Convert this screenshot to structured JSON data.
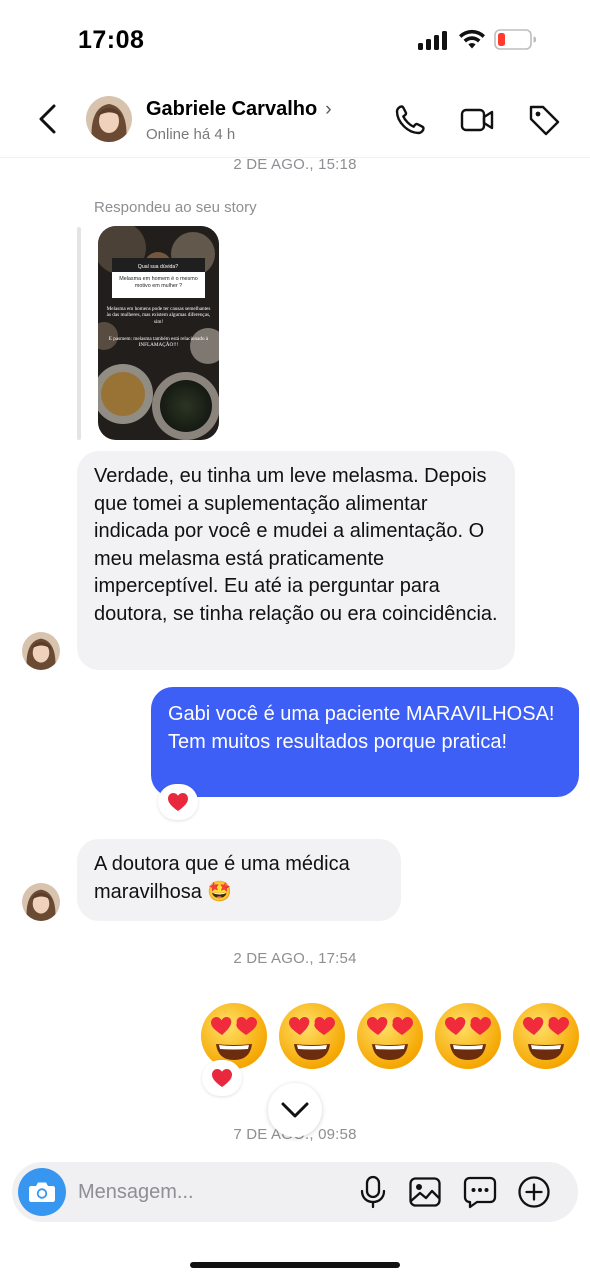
{
  "status_bar": {
    "time": "17:08"
  },
  "header": {
    "contact_name": "Gabriele Carvalho",
    "presence": "Online há 4 h"
  },
  "conversation": {
    "timestamp_1": "2 DE AGO., 15:18",
    "story_reply_label": "Respondeu ao seu story",
    "story": {
      "question_header": "Qual sua dúvida?",
      "question": "Melasma em homem é o mesmo motivo em mulher ?",
      "answer": "Melasma em homens pode ter causas semelhantes às das mulheres, mas existem algumas diferenças, sim!",
      "answer_2": "E pasmem: melasma também está relacionado à INFLAMAÇÃO!!!"
    },
    "message_1": "Verdade, eu tinha um leve melasma. Depois que tomei a suplementação alimentar indicada por você e mudei a alimentação. O meu melasma está praticamente imperceptível. Eu até ia perguntar para doutora, se tinha relação ou era coincidência.",
    "message_2": "Gabi você é uma paciente MARAVILHOSA! Tem muitos resultados porque pratica!",
    "message_3": "A doutora que é uma médica maravilhosa 🤩",
    "timestamp_2": "2 DE AGO., 17:54",
    "timestamp_3": "7 DE AGO., 09:58"
  },
  "composer": {
    "placeholder": "Mensagem..."
  },
  "colors": {
    "accent_blue": "#3e5ff5",
    "camera_blue": "#3797f0",
    "incoming_bubble": "#f2f2f4",
    "reaction_heart": "#e8283c"
  },
  "icons": [
    "back-chevron-icon",
    "phone-icon",
    "video-call-icon",
    "tag-icon",
    "heart-reaction-icon",
    "heart-eyes-emoji-icon",
    "star-struck-emoji-icon",
    "chevron-down-icon",
    "camera-icon",
    "microphone-icon",
    "gallery-icon",
    "sticker-chat-icon",
    "plus-circle-icon"
  ]
}
